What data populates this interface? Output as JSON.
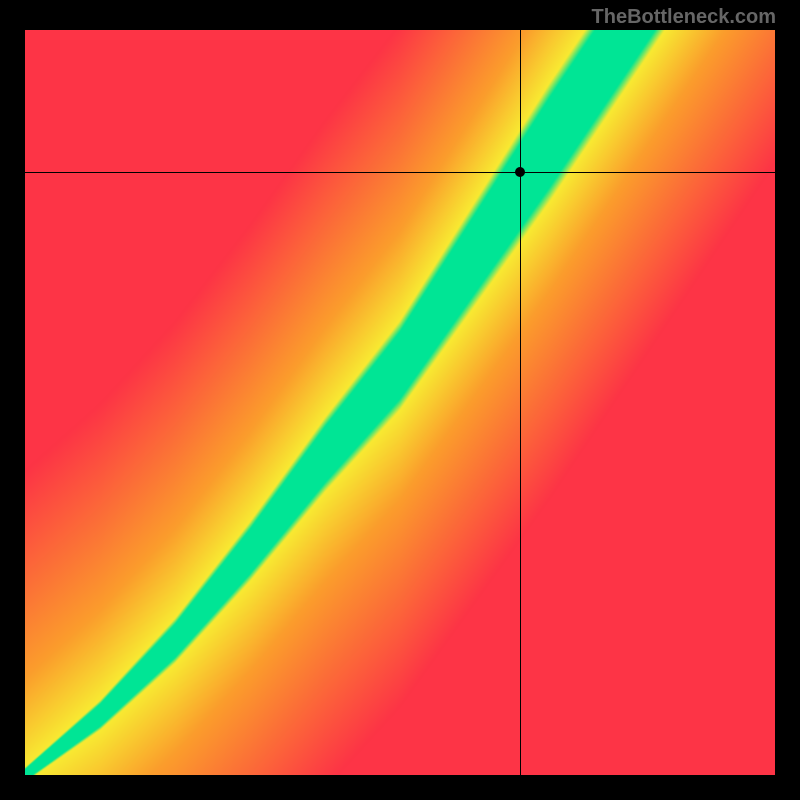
{
  "watermark": "TheBottleneck.com",
  "chart_data": {
    "type": "heatmap",
    "title": "",
    "xlabel": "",
    "ylabel": "",
    "xlim": [
      0,
      100
    ],
    "ylim": [
      0,
      100
    ],
    "crosshair": {
      "x": 66,
      "y": 81
    },
    "optimal_band": {
      "description": "Green diagonal band curving from bottom-left to upper-right indicating optimal pairing; colors grade red->yellow->green->yellow->red across distance from band",
      "points": [
        {
          "x": 0,
          "center_y": 0,
          "half_width": 1
        },
        {
          "x": 10,
          "center_y": 8,
          "half_width": 2
        },
        {
          "x": 20,
          "center_y": 18,
          "half_width": 3
        },
        {
          "x": 30,
          "center_y": 30,
          "half_width": 4
        },
        {
          "x": 40,
          "center_y": 43,
          "half_width": 5
        },
        {
          "x": 50,
          "center_y": 55,
          "half_width": 6
        },
        {
          "x": 60,
          "center_y": 70,
          "half_width": 7
        },
        {
          "x": 70,
          "center_y": 85,
          "half_width": 8
        },
        {
          "x": 80,
          "center_y": 100,
          "half_width": 8
        }
      ]
    },
    "colors": {
      "optimal": "#00E595",
      "near": "#F8EA32",
      "mid": "#FB9E2C",
      "far": "#FD3446"
    }
  }
}
